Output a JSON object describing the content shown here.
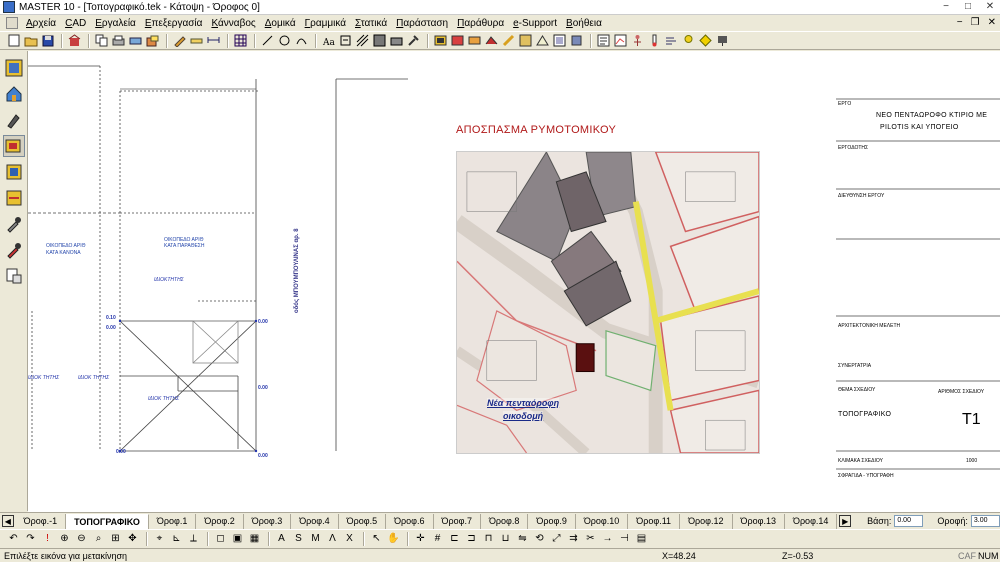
{
  "window": {
    "title": "MASTER 10 - [Τοπογραφικό.tek - Κάτοψη - Όροφος 0]",
    "controls": [
      "−",
      "□",
      "✕"
    ]
  },
  "menu": {
    "items": [
      "Αρχεία",
      "CAD",
      "Εργαλεία",
      "Επεξεργασία",
      "Κάνναβος",
      "Δομικά",
      "Γραμμικά",
      "Στατικά",
      "Παράσταση",
      "Παράθυρα",
      "e-Support",
      "Βοήθεια"
    ],
    "mdi_controls": [
      "−",
      "❐",
      "✕"
    ]
  },
  "canvas": {
    "excerpt_title": "ΑΠΟΣΠΑΣΜΑ ΡΥΜΟΤΟΜΙΚΟΥ",
    "map_label_line1": "Νέα πενταόροφη",
    "map_label_line2": "οικοδομή",
    "street_label": "οδός ΜΠΟΥΜΠΟΥΛΙΝΑΣ αρ. 8",
    "dims": [
      "0.10",
      "0.00",
      "0.00",
      "0.00",
      "0.00",
      "0.00"
    ],
    "blue_notes": [
      "ΟΙΚΟΠΕΔΟ ΑΡΙΘ",
      "ΚΑΤΑ ΚΑΝΟΝΑ",
      "ΟΙΚΟΠΕΔΟ ΑΡΙΘ",
      "ΚΑΤΑ ΠΑΡΑΘΕΣΗ",
      "ΙΔΙΟΚΤΗΤΗΣ",
      "ΙΔΙΟΚ ΤΗΤΗΣ",
      "ΙΔΙΟΚ ΤΗΤΗΣ",
      "ΙΔΙΟΚ ΤΗΤΗΣ"
    ]
  },
  "title_block": {
    "project_label": "ΕΡΓΟ",
    "project_line1": "ΝΕΟ ΠΕΝΤΑΩΡΟΦΟ ΚΤΙΡΙΟ ΜΕ",
    "project_line2": "PILOTIS ΚΑΙ ΥΠΟΓΕΙΟ",
    "client_label": "ΕΡΓΟΔΟΤΗΣ",
    "management_label": "ΔΙΕΥΘΥΝΣΗ ΕΡΓΟΥ",
    "architectural_label": "ΑΡΧΙΤΕΚΤΟΝΙΚΗ ΜΕΛΕΤΗ",
    "collaboration_label": "ΣΥΝΕΡΓΑΤΡΙΑ",
    "drawing_subject_label": "ΘΕΜΑ ΣΧΕΔΙΟΥ",
    "drawing_number_label": "ΑΡΙΘΜΟΣ ΣΧΕΔΙΟΥ",
    "drawing_subject": "ΤΟΠΟΓΡΑΦΙΚΟ",
    "drawing_number": "Τ1",
    "scale_label": "ΚΛΙΜΑΚΑ ΣΧΕΔΙΟΥ",
    "scale_value": "1000",
    "stamp_label": "ΣΦΡΑΓΙΔΑ - ΥΠΟΓΡΑΦΗ"
  },
  "tabs": {
    "items": [
      "Όροφ.-1",
      "ΤΟΠΟΓΡΑΦΙΚΟ",
      "Όροφ.1",
      "Όροφ.2",
      "Όροφ.3",
      "Όροφ.4",
      "Όροφ.5",
      "Όροφ.6",
      "Όροφ.7",
      "Όροφ.8",
      "Όροφ.9",
      "Όροφ.10",
      "Όροφ.11",
      "Όροφ.12",
      "Όροφ.13",
      "Όροφ.14"
    ],
    "active_index": 1,
    "base_label": "Βάση:",
    "base_value": "0.00",
    "floor_label": "Οροφή:",
    "floor_value": "3.00"
  },
  "status": {
    "message": "Επιλέξτε εικόνα για μετακίνηση",
    "x_coord": "X=48.24",
    "z_coord": "Z=-0.53",
    "caf": "CAF",
    "num": "NUM"
  },
  "colors": {
    "accent_red": "#b01818",
    "drawing_blue": "#2233aa",
    "ui_gray": "#ece9d8"
  }
}
